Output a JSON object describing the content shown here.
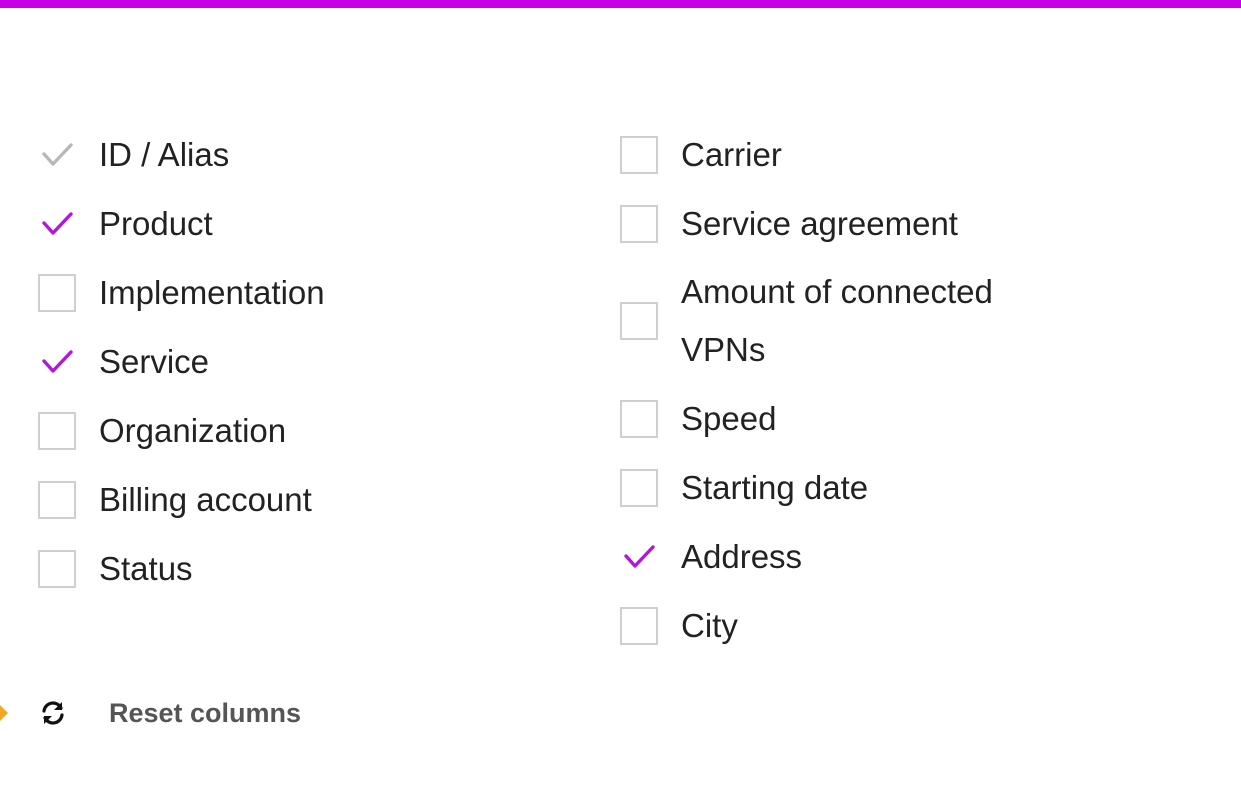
{
  "accent_color": "#c800e6",
  "check_color": "#b415dc",
  "disabled_check_color": "#b8b8b8",
  "columns_left": [
    {
      "label": "ID / Alias",
      "checked": true,
      "disabled": true
    },
    {
      "label": "Product",
      "checked": true,
      "disabled": false
    },
    {
      "label": "Implementation",
      "checked": false,
      "disabled": false
    },
    {
      "label": "Service",
      "checked": true,
      "disabled": false
    },
    {
      "label": "Organization",
      "checked": false,
      "disabled": false
    },
    {
      "label": "Billing account",
      "checked": false,
      "disabled": false
    },
    {
      "label": "Status",
      "checked": false,
      "disabled": false
    }
  ],
  "columns_right": [
    {
      "label": "Carrier",
      "checked": false,
      "disabled": false
    },
    {
      "label": "Service agreement",
      "checked": false,
      "disabled": false
    },
    {
      "label": "Amount of connected VPNs",
      "checked": false,
      "disabled": false
    },
    {
      "label": "Speed",
      "checked": false,
      "disabled": false
    },
    {
      "label": "Starting date",
      "checked": false,
      "disabled": false
    },
    {
      "label": "Address",
      "checked": true,
      "disabled": false
    },
    {
      "label": "City",
      "checked": false,
      "disabled": false
    }
  ],
  "reset": {
    "label": "Reset columns",
    "icon": "refresh-icon",
    "indicator_icon": "chevron-right-icon"
  }
}
